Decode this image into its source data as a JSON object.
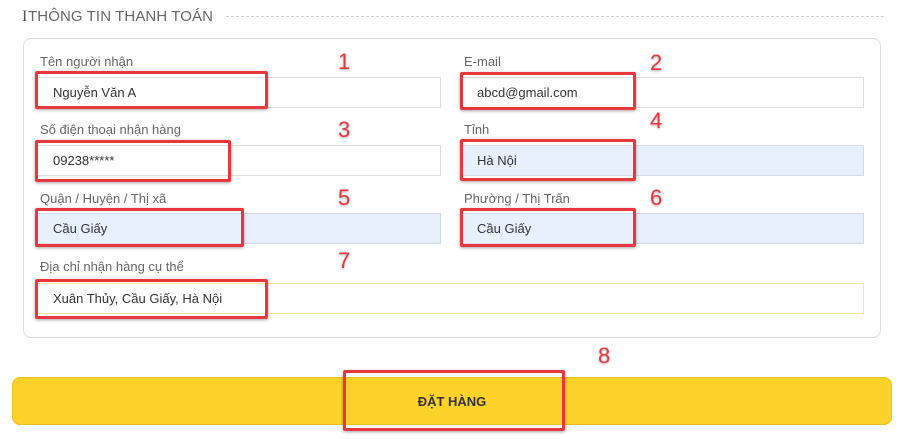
{
  "section": {
    "title": "THÔNG TIN THANH TOÁN"
  },
  "fields": {
    "receiver_name": {
      "label": "Tên người nhận",
      "value": "Nguyễn Văn A"
    },
    "email": {
      "label": "E-mail",
      "value": "abcd@gmail.com"
    },
    "phone": {
      "label": "Số điện thoại nhận hàng",
      "value": "09238*****"
    },
    "province": {
      "label": "Tỉnh",
      "value": "Hà Nội"
    },
    "district": {
      "label": "Quận / Huyện / Thị xã",
      "value": "Cầu Giấy"
    },
    "ward": {
      "label": "Phường / Thị Trấn",
      "value": "Cầu Giấy"
    },
    "address": {
      "label": "Địa chỉ nhận hàng cụ thể",
      "value": "Xuân Thủy, Cầu Giấy, Hà Nội"
    }
  },
  "submit": {
    "label": "ĐẶT HÀNG"
  },
  "annotations": [
    "1",
    "2",
    "3",
    "4",
    "5",
    "6",
    "7",
    "8"
  ],
  "colors": {
    "accent": "#fcd12a",
    "marker": "#e8383d",
    "autofill": "#e8f0fe"
  }
}
